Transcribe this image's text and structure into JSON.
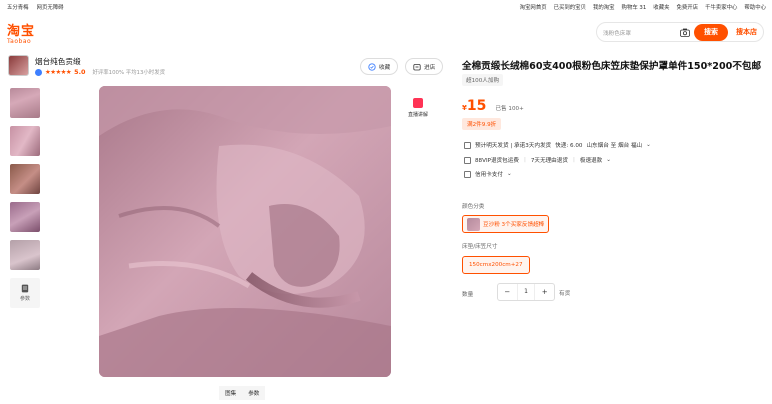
{
  "topbar": {
    "left": [
      "五分青梅",
      "网页无障碍"
    ],
    "right": [
      "淘宝网首页",
      "已买到的宝贝",
      "我的淘宝",
      "购物车 31",
      "收藏夹",
      "免费开店",
      "千牛卖家中心",
      "帮助中心"
    ]
  },
  "brand": {
    "cn": "淘宝",
    "en": "Taobao"
  },
  "search": {
    "placeholder": "浅粉色床罩",
    "button": "搜索",
    "shop_button": "搜本店"
  },
  "shop": {
    "name": "烟台纯色贡缎",
    "score": "5.0",
    "stars": "★★★★★",
    "meta": "好评率100%  平均13小时发货"
  },
  "actions": {
    "favorite": "收藏",
    "enter_shop": "进店"
  },
  "live": {
    "label": "直播讲解"
  },
  "gallery_tabs": [
    "图集",
    "参数"
  ],
  "thumbs": {
    "param_label": "参数"
  },
  "product": {
    "title": "全棉贡缎长绒棉60支400根粉色床笠床垫保护罩单件150*200不包邮",
    "added": "超100人加购",
    "currency": "¥",
    "price": "15",
    "sold": "已售 100+",
    "promo": "满2件9.9折",
    "shipping": "预计明天发货 | 承诺3天内发货",
    "freight": "快递: 6.00",
    "route": "山东烟台 至 烟台 福山",
    "service1": "88VIP退货包运费",
    "service2": "7天无理由退货",
    "service3": "极速退款",
    "pay": "信用卡支付"
  },
  "sku": {
    "color_label": "颜色分类",
    "color_value": "豆沙粉 3个买家反馈超棒",
    "size_label": "床垫/床笠尺寸",
    "size_value": "150cmx200cm+27"
  },
  "quantity": {
    "label": "数量",
    "value": "1",
    "stock": "有货"
  }
}
